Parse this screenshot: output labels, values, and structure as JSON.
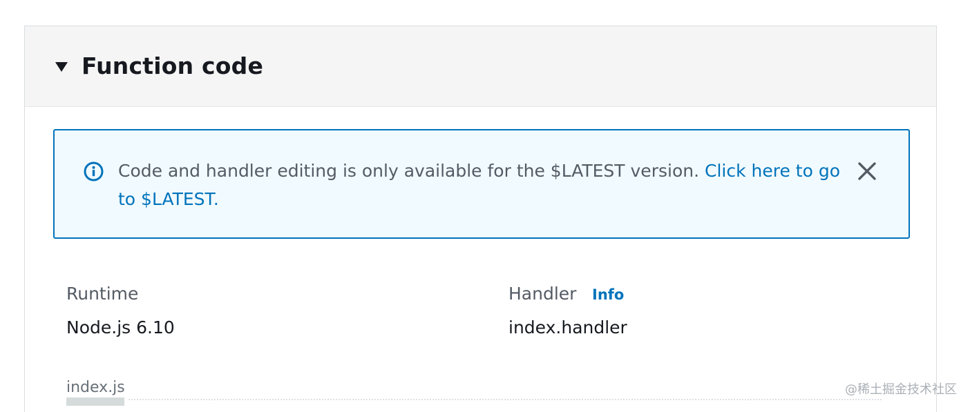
{
  "panel": {
    "title": "Function code"
  },
  "alert": {
    "message": "Code and handler editing is only available for the $LATEST version.",
    "link_text_line1": "Click here to go",
    "link_text_line2": "to $LATEST."
  },
  "fields": {
    "runtime_label": "Runtime",
    "runtime_value": "Node.js 6.10",
    "handler_label": "Handler",
    "handler_info": "Info",
    "handler_value": "index.handler"
  },
  "editor": {
    "file_tab": "index.js"
  },
  "watermark": "@稀土掘金技术社区",
  "icons": {
    "collapse": "caret-down-icon",
    "info": "info-circle-icon",
    "close": "close-icon"
  },
  "colors": {
    "accent": "#0073bb",
    "alert_bg": "#f1faff",
    "header_bg": "#f5f5f5",
    "text_primary": "#16191f",
    "text_secondary": "#545b64"
  }
}
